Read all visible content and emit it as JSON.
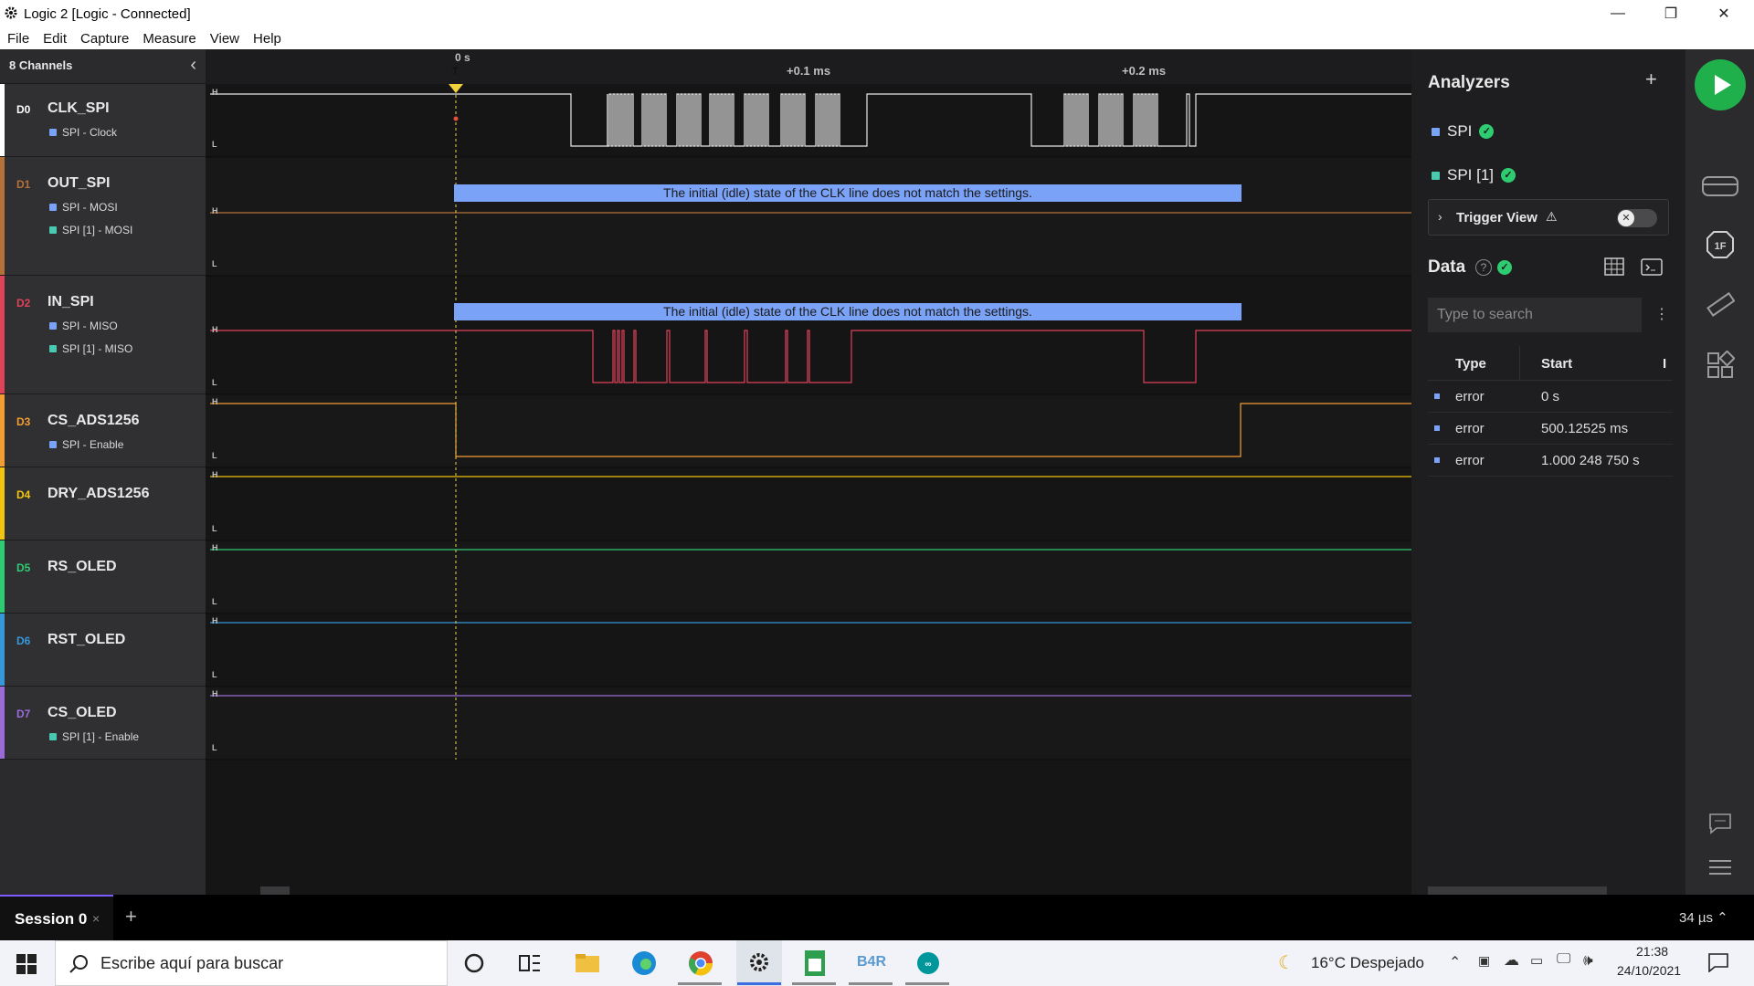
{
  "window": {
    "title": "Logic 2 [Logic - Connected]"
  },
  "menu": [
    "File",
    "Edit",
    "Capture",
    "Measure",
    "View",
    "Help"
  ],
  "channels_header": "8 Channels",
  "time_ticks": [
    "0 s",
    "+0.1 ms",
    "+0.2 ms"
  ],
  "trigger_marker": "T",
  "channels": [
    {
      "index": "D0",
      "name": "CLK_SPI",
      "color": "#ffffff",
      "analyzers": [
        {
          "label": "SPI - Clock",
          "color": "#7aa2f7"
        }
      ]
    },
    {
      "index": "D1",
      "name": "OUT_SPI",
      "color": "#b5713a",
      "analyzers": [
        {
          "label": "SPI - MOSI",
          "color": "#7aa2f7"
        },
        {
          "label": "SPI [1] - MOSI",
          "color": "#48c9b0"
        }
      ]
    },
    {
      "index": "D2",
      "name": "IN_SPI",
      "color": "#e0425a",
      "analyzers": [
        {
          "label": "SPI - MISO",
          "color": "#7aa2f7"
        },
        {
          "label": "SPI [1] - MISO",
          "color": "#48c9b0"
        }
      ]
    },
    {
      "index": "D3",
      "name": "CS_ADS1256",
      "color": "#f39c32",
      "analyzers": [
        {
          "label": "SPI - Enable",
          "color": "#7aa2f7"
        }
      ]
    },
    {
      "index": "D4",
      "name": "DRY_ADS1256",
      "color": "#f1c40f",
      "analyzers": []
    },
    {
      "index": "D5",
      "name": "RS_OLED",
      "color": "#2ecc71",
      "analyzers": []
    },
    {
      "index": "D6",
      "name": "RST_OLED",
      "color": "#3498db",
      "analyzers": []
    },
    {
      "index": "D7",
      "name": "CS_OLED",
      "color": "#9b6bd9",
      "analyzers": [
        {
          "label": "SPI [1] - Enable",
          "color": "#48c9b0"
        }
      ]
    }
  ],
  "level_labels": {
    "high": "H",
    "low": "L"
  },
  "error_message": "The initial (idle) state of the CLK line does not match the settings.",
  "analyzers_panel": {
    "title": "Analyzers",
    "add": "+",
    "items": [
      "SPI",
      "SPI [1]"
    ],
    "trigger_view": "Trigger View",
    "trigger_warning": "⚠"
  },
  "data_panel": {
    "title": "Data",
    "help": "?",
    "search_placeholder": "Type to search",
    "columns": [
      "Type",
      "Start",
      "I"
    ],
    "rows": [
      {
        "type": "error",
        "start": "0 s"
      },
      {
        "type": "error",
        "start": "500.12525 ms"
      },
      {
        "type": "error",
        "start": "1.000 248 750 s"
      }
    ]
  },
  "rail_icons": [
    "play-icon",
    "device-icon",
    "1f-icon",
    "ruler-icon",
    "extensions-icon",
    "chat-icon",
    "menu-icon"
  ],
  "session": {
    "tab": "Session 0",
    "close": "×",
    "add": "+",
    "zoom": "34 µs ⌃"
  },
  "taskbar": {
    "search_placeholder": "Escribe aquí para buscar",
    "weather": "16°C  Despejado",
    "time": "21:38",
    "date": "24/10/2021",
    "b4r": "B4R"
  },
  "colors": {
    "accent_blue": "#7aa2f7",
    "play_green": "#1fb04c",
    "ok_green": "#2ecc71"
  }
}
